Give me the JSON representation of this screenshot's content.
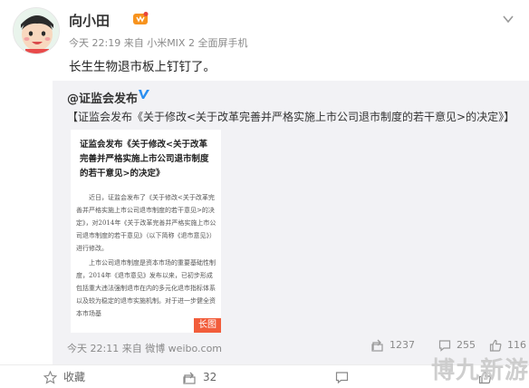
{
  "post": {
    "username": "向小田",
    "meta": "今天 22:19 来自 小米MIX 2 全面屏手机",
    "text": "长生生物退市板上钉钉了。"
  },
  "repost": {
    "author": "@证监会发布",
    "text": "【证监会发布《关于修改<关于改革完善并严格实施上市公司退市制度的若干意见>的决定》】",
    "document": {
      "title": "证监会发布《关于修改<关于改革完善并严格实施上市公司退市制度的若干意见>的决定》",
      "paragraph1": "近日，证监会发布了《关于修改<关于改革完善并严格实施上市公司退市制度的若干意见>的决定》，对2014年《关于改革完善并严格实施上市公司退市制度的若干意见》（以下简称《退市意见》）进行修改。",
      "paragraph2": "上市公司退市制度是资本市场的重要基础性制度，2014年《退市意见》发布以来，已初步形成包括重大违法强制退市在内的多元化退市指标体系以及较为稳定的退市实施机制。对于进一步健全资本市场基",
      "long_tag": "长图"
    },
    "meta": "今天 22:11 来自 微博 weibo.com",
    "forward_count": "1237",
    "comment_count": "255",
    "like_count": "116"
  },
  "footer": {
    "favorite_label": "收藏",
    "forward_count": "32",
    "comment_icon": "comment-icon",
    "like_icon": "like-icon"
  },
  "watermark": "博九新游",
  "colors": {
    "repost_bg": "#f2f2f5",
    "badge_orange": "#f7931e",
    "verified_blue": "#2a8ef0",
    "long_tag": "#f25d3b"
  }
}
